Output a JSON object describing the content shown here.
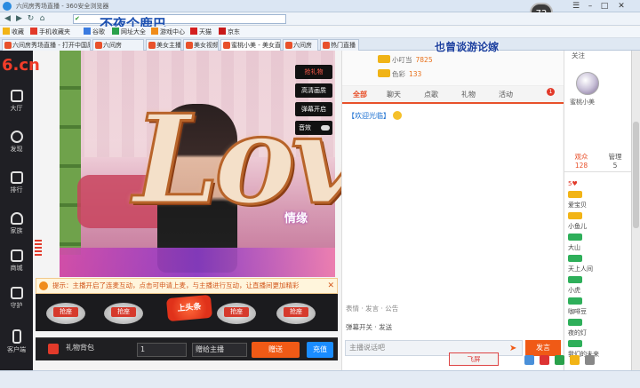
{
  "browser": {
    "window_title": "六间房秀场直播 - 360安全浏览器",
    "zoom_level": "72",
    "address": "v.6.cn/fenghua",
    "overlay_left": "不夜个鹿巴",
    "overlay_right": "也曾谈游论嫁"
  },
  "favorites": [
    "收藏",
    "手机收藏夹",
    "谷歌",
    "网址大全",
    "游戏中心",
    "天猫",
    "京东",
    "导航",
    "爱淘宝"
  ],
  "tabs": [
    {
      "label": "六间房秀场直播 - 打开中国原创..."
    },
    {
      "label": "六间房"
    },
    {
      "label": "美女主播"
    },
    {
      "label": "美女视频"
    },
    {
      "label": "蜜桃小美 - 美女直播间",
      "active": true
    },
    {
      "label": "六间房"
    },
    {
      "label": "热门直播"
    }
  ],
  "sitenav": {
    "logo": "6.cn",
    "logo_sub": "六间房",
    "items": [
      "大厅",
      "发现",
      "排行",
      "家族",
      "商城",
      "守护",
      "客户端"
    ]
  },
  "video": {
    "buttons": [
      "抢礼物",
      "高清画质",
      "弹幕开启",
      "音效"
    ],
    "caption": "情缘"
  },
  "overlay_graphic": "Love",
  "notice": {
    "text": "提示：主播开启了连麦互动，点击可申请上麦，与主播进行互动，让直播间更加精彩",
    "close": "✕"
  },
  "gifts": {
    "labels": [
      "抢座",
      "抢座",
      "抢座",
      "抢座",
      "抢座"
    ],
    "headline": "上头条",
    "gift_button": "礼物背包",
    "quantity": "1",
    "recipient": "赠给主播",
    "send": "赠送",
    "recharge": "充值"
  },
  "chat": {
    "rank": [
      {
        "name": "小叮当",
        "count": "7825"
      },
      {
        "name": "色彩",
        "count": "133"
      }
    ],
    "tabs": [
      "全部",
      "聊天",
      "点歌",
      "礼物",
      "活动"
    ],
    "tab_badge": "1",
    "message": "【欢迎光临】",
    "tools": "表情  ·  发言  ·  公告",
    "options": "弹幕开关  ·  发送",
    "input_placeholder": "主播说话吧",
    "send": "发言"
  },
  "host": {
    "top_label": "关注",
    "name": "蜜桃小美"
  },
  "audience": {
    "tabs": [
      {
        "label": "观众",
        "count": "128"
      },
      {
        "label": "管理",
        "count": "5"
      }
    ],
    "heart": "5♥",
    "items": [
      {
        "badge": "gold",
        "name": "爱宝贝"
      },
      {
        "badge": "gold",
        "name": "小鱼儿"
      },
      {
        "badge": "green",
        "name": "大山"
      },
      {
        "badge": "green",
        "name": "天上人间"
      },
      {
        "badge": "green",
        "name": "小虎"
      },
      {
        "badge": "green",
        "name": "咖啡豆"
      },
      {
        "badge": "green",
        "name": "夜的灯"
      },
      {
        "badge": "green",
        "name": "我们的未来"
      }
    ]
  },
  "fly_button": "飞屏",
  "colors": {
    "brand": "#e8512b",
    "send": "#f05a16",
    "recharge": "#1a8cff",
    "sidebar": "#1f1f24"
  }
}
